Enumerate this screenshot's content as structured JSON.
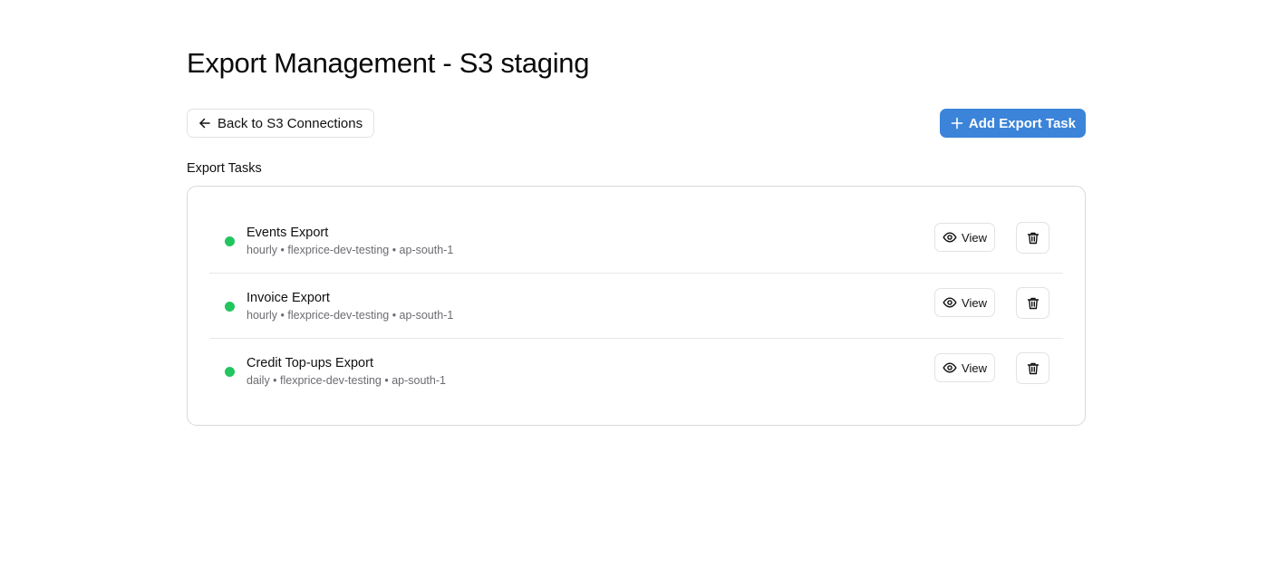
{
  "page": {
    "title": "Export Management - S3 staging"
  },
  "toolbar": {
    "back_label": "Back to S3 Connections",
    "back_icon": "arrow-left-icon",
    "add_label": "Add Export Task",
    "add_icon": "plus-icon",
    "accent_color": "#3b84d9"
  },
  "tasks_section": {
    "label": "Export Tasks",
    "status_color": "#22c55e",
    "view_label": "View",
    "view_icon": "eye-icon",
    "delete_icon": "trash-icon",
    "tasks": [
      {
        "name": "Events Export",
        "meta": "hourly • flexprice-dev-testing • ap-south-1",
        "status": "active"
      },
      {
        "name": "Invoice Export",
        "meta": "hourly • flexprice-dev-testing • ap-south-1",
        "status": "active"
      },
      {
        "name": "Credit Top-ups Export",
        "meta": "daily • flexprice-dev-testing • ap-south-1",
        "status": "active"
      }
    ]
  }
}
